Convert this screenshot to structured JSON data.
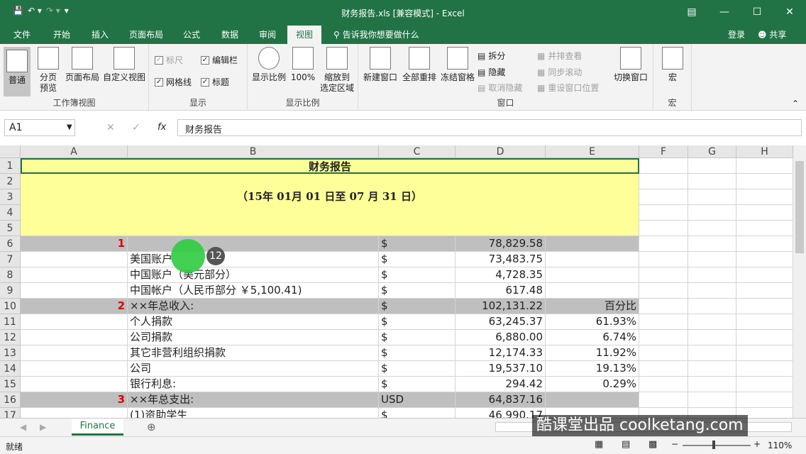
{
  "window": {
    "title": "财务报告.xls  [兼容模式] - Excel"
  },
  "tabs": [
    "文件",
    "开始",
    "插入",
    "页面布局",
    "公式",
    "数据",
    "审阅",
    "视图"
  ],
  "tell": "告诉我你想要做什么",
  "login": "登录",
  "share": "共享",
  "ribbon": {
    "workbook_views": {
      "label": "工作簿视图",
      "normal": "普通",
      "page_break": "分页\n预览",
      "page_layout": "页面布局",
      "custom": "自定义视图"
    },
    "show": {
      "label": "显示",
      "ruler": "标尺",
      "formula_bar": "编辑栏",
      "gridlines": "网格线",
      "headings": "标题"
    },
    "zoom": {
      "label": "显示比例",
      "zoom": "显示比例",
      "hundred": "100%",
      "zoom_sel": "缩放到\n选定区域"
    },
    "window": {
      "label": "窗口",
      "new_window": "新建窗口",
      "arrange_all": "全部重排",
      "freeze": "冻结窗格",
      "split": "拆分",
      "hide": "隐藏",
      "unhide": "取消隐藏",
      "side_by_side": "并排查看",
      "sync_scroll": "同步滚动",
      "reset_pos": "重设窗口位置",
      "switch": "切换窗口"
    },
    "macros": {
      "label": "宏",
      "macros": "宏"
    }
  },
  "formula": {
    "namebox": "A1",
    "content": "财务报告"
  },
  "columns": [
    "A",
    "B",
    "C",
    "D",
    "E",
    "F",
    "G",
    "H"
  ],
  "rows": [
    {
      "n": "1",
      "title": "财务报告"
    },
    {
      "n": "2"
    },
    {
      "n": "3",
      "subtitle": "（15年  01月  01 日至  07  月  31  日）"
    },
    {
      "n": "4"
    },
    {
      "n": "5"
    },
    {
      "n": "6",
      "a": "1",
      "b": "",
      "c": "$",
      "d": "78,829.58",
      "e": ""
    },
    {
      "n": "7",
      "a": "",
      "b": "美国账户",
      "c": "$",
      "d": "73,483.75",
      "e": ""
    },
    {
      "n": "8",
      "a": "",
      "b": "中国账户（美元部分）",
      "c": "$",
      "d": "4,728.35",
      "e": ""
    },
    {
      "n": "9",
      "a": "",
      "b": "中国帐户（人民币部分 ￥5,100.41)",
      "c": "$",
      "d": "617.48",
      "e": ""
    },
    {
      "n": "10",
      "a": "2",
      "b": "××年总收入:",
      "c": "$",
      "d": "102,131.22",
      "e": "百分比"
    },
    {
      "n": "11",
      "a": "",
      "b": "个人捐款",
      "c": "$",
      "d": "63,245.37",
      "e": "61.93%"
    },
    {
      "n": "12",
      "a": "",
      "b": "公司捐款",
      "c": "$",
      "d": "6,880.00",
      "e": "6.74%"
    },
    {
      "n": "13",
      "a": "",
      "b": "其它非营利组织捐款",
      "c": "$",
      "d": "12,174.33",
      "e": "11.92%"
    },
    {
      "n": "14",
      "a": "",
      "b": "公司",
      "c": "$",
      "d": "19,537.10",
      "e": "19.13%"
    },
    {
      "n": "15",
      "a": "",
      "b": "银行利息:",
      "c": "$",
      "d": "294.42",
      "e": "0.29%"
    },
    {
      "n": "16",
      "a": "3",
      "b": "××年总支出:",
      "c": "USD",
      "d": "64,837.16",
      "e": ""
    },
    {
      "n": "17",
      "a": "",
      "b": "(1)资助学生",
      "c": "$",
      "d": "46,990.17",
      "e": ""
    }
  ],
  "sheet": {
    "name": "Finance"
  },
  "status": {
    "ready": "就绪",
    "zoom": "110%"
  },
  "overlay": {
    "step": "12",
    "watermark": "酷课堂出品 coolketang.com"
  }
}
